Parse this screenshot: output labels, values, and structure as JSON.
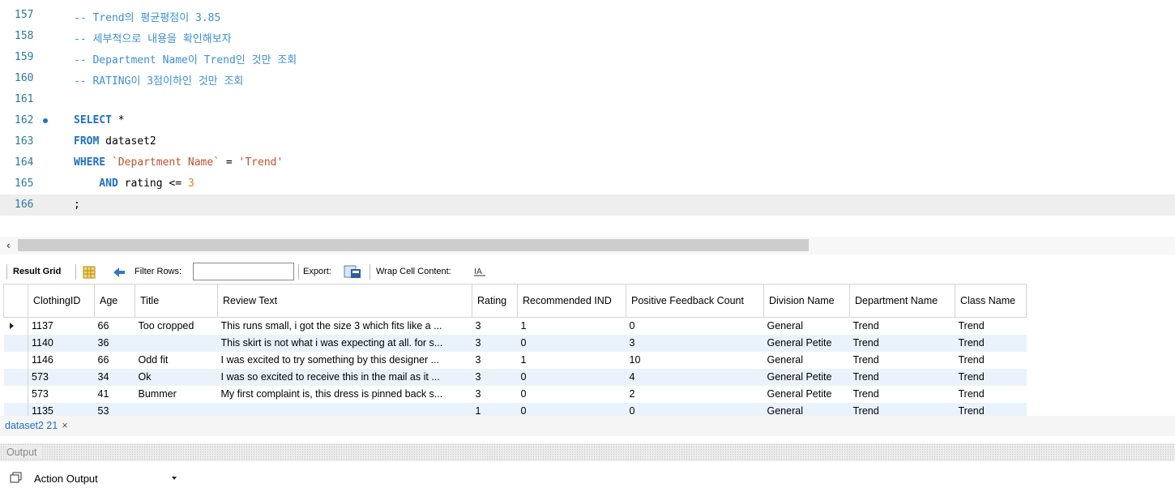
{
  "editor": {
    "lines": [
      {
        "num": "157",
        "parts": [
          {
            "t": "-- Trend의 평균평점이 3.85",
            "c": "cmt"
          }
        ]
      },
      {
        "num": "158",
        "parts": [
          {
            "t": "-- 세부적으로 내용을 확인해보자",
            "c": "cmt"
          }
        ]
      },
      {
        "num": "159",
        "parts": [
          {
            "t": "-- Department Name이 Trend인 것만 조회",
            "c": "cmt"
          }
        ]
      },
      {
        "num": "160",
        "parts": [
          {
            "t": "-- RATING이 3점이하인 것만 조회",
            "c": "cmt"
          }
        ]
      },
      {
        "num": "161",
        "parts": []
      },
      {
        "num": "162",
        "parts": [
          {
            "t": "SELECT",
            "c": "kw"
          },
          {
            "t": " *",
            "c": "plain"
          }
        ],
        "breakpoint": true
      },
      {
        "num": "163",
        "parts": [
          {
            "t": "FROM",
            "c": "kw"
          },
          {
            "t": " dataset2",
            "c": "plain"
          }
        ]
      },
      {
        "num": "164",
        "parts": [
          {
            "t": "WHERE",
            "c": "kw"
          },
          {
            "t": " ",
            "c": "plain"
          },
          {
            "t": "`Department Name`",
            "c": "str"
          },
          {
            "t": " = ",
            "c": "plain"
          },
          {
            "t": "'Trend'",
            "c": "str"
          }
        ]
      },
      {
        "num": "165",
        "parts": [
          {
            "t": "    AND",
            "c": "kw"
          },
          {
            "t": " rating <= ",
            "c": "plain"
          },
          {
            "t": "3",
            "c": "num"
          }
        ]
      },
      {
        "num": "166",
        "parts": [
          {
            "t": ";",
            "c": "plain"
          }
        ],
        "current": true
      }
    ]
  },
  "toolbar": {
    "result_grid": "Result Grid",
    "filter_rows": "Filter Rows:",
    "filter_value": "",
    "export": "Export:",
    "wrap": "Wrap Cell Content:"
  },
  "grid": {
    "columns": [
      {
        "label": "ClothingID",
        "w": 82
      },
      {
        "label": "Age",
        "w": 50
      },
      {
        "label": "Title",
        "w": 102
      },
      {
        "label": "Review Text",
        "w": 314
      },
      {
        "label": "Rating",
        "w": 56
      },
      {
        "label": "Recommended IND",
        "w": 134
      },
      {
        "label": "Positive Feedback Count",
        "w": 170
      },
      {
        "label": "Division Name",
        "w": 106
      },
      {
        "label": "Department Name",
        "w": 130
      },
      {
        "label": "Class Name",
        "w": 88
      }
    ],
    "rows": [
      [
        "1137",
        "66",
        "Too cropped",
        "This runs small, i got the size 3 which fits like a ...",
        "3",
        "1",
        "0",
        "General",
        "Trend",
        "Trend"
      ],
      [
        "1140",
        "36",
        "",
        "This skirt is not what i was expecting at all. for s...",
        "3",
        "0",
        "3",
        "General Petite",
        "Trend",
        "Trend"
      ],
      [
        "1146",
        "66",
        "Odd fit",
        "I was excited to try something by this designer ...",
        "3",
        "1",
        "10",
        "General",
        "Trend",
        "Trend"
      ],
      [
        "573",
        "34",
        "Ok",
        "I was so excited to receive this in the mail as it ...",
        "3",
        "0",
        "4",
        "General Petite",
        "Trend",
        "Trend"
      ],
      [
        "573",
        "41",
        "Bummer",
        "My first complaint is, this dress is pinned back s...",
        "3",
        "0",
        "2",
        "General Petite",
        "Trend",
        "Trend"
      ],
      [
        "1135",
        "53",
        "",
        "",
        "1",
        "0",
        "0",
        "General",
        "Trend",
        "Trend"
      ]
    ]
  },
  "tab": {
    "label": "dataset2 21",
    "close": "×"
  },
  "output": {
    "title": "Output",
    "select_value": "Action Output"
  }
}
